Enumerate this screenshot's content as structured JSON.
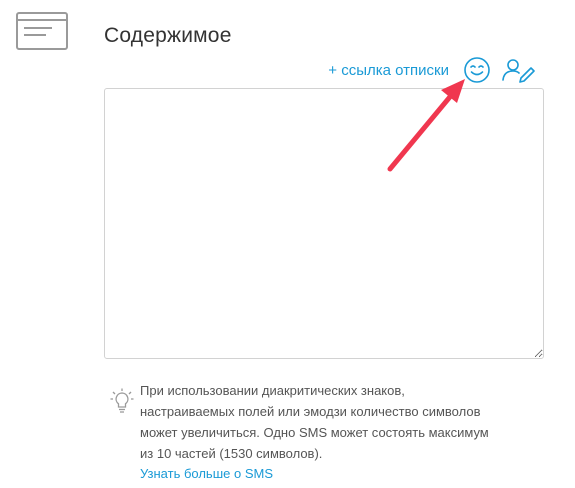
{
  "section": {
    "title": "Содержимое",
    "icon": "message-card-icon"
  },
  "toolbar": {
    "unsubscribe_link": "+ ссылка отписки",
    "emoji_icon": "smiley-face-icon",
    "personalize_icon": "user-edit-icon"
  },
  "editor": {
    "value": "",
    "placeholder": ""
  },
  "hint": {
    "icon": "lightbulb-icon",
    "lines": [
      "При использовании диакритических знаков,",
      "настраиваемых полей или эмодзи количество символов",
      "может увеличиться. Одно SMS может состоять максимум",
      "из 10 частей (1530 символов)."
    ],
    "learn_more": "Узнать больше о SMS"
  },
  "colors": {
    "accent": "#1a9ad6",
    "annotation_arrow": "#f0374f",
    "text": "#333333",
    "muted": "#555555",
    "border": "#d2d2d2"
  }
}
